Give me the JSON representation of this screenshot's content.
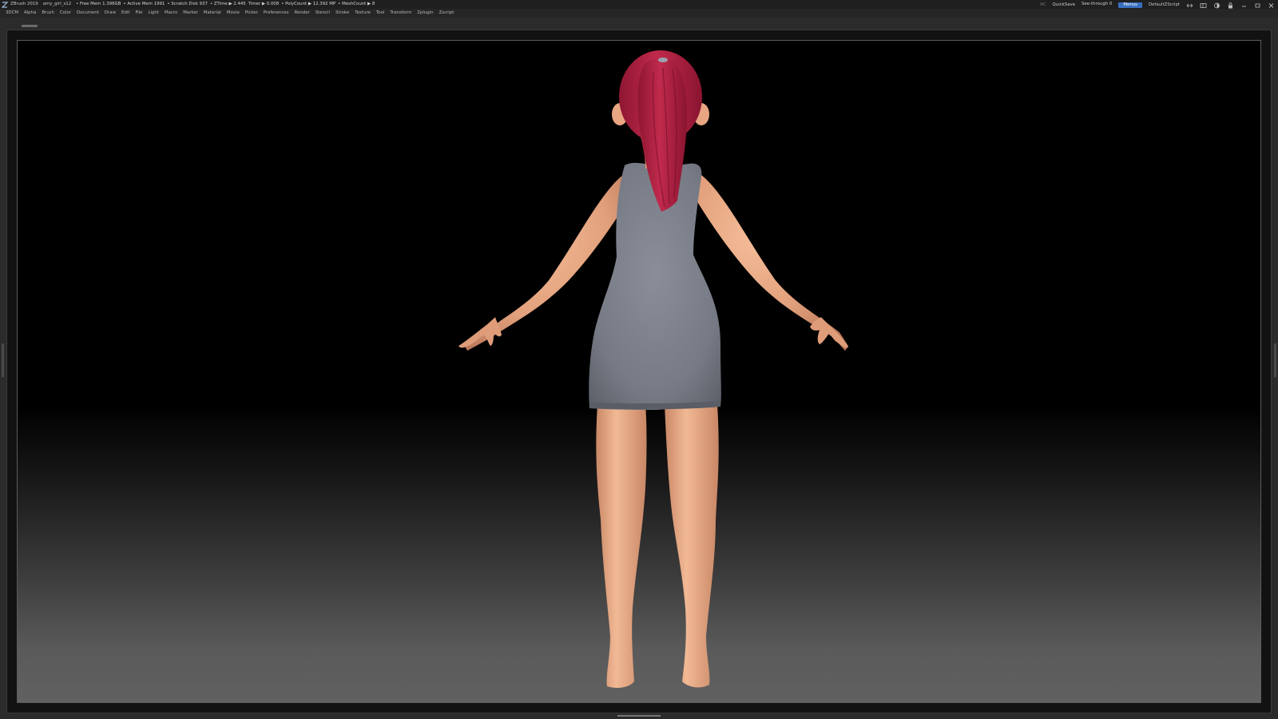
{
  "titlebar": {
    "app_name": "ZBrush 2019",
    "doc_name": "amy_girl_s12",
    "status": [
      "• Free Mem 1.396GB",
      "• Active Mem 1991",
      "• Scratch Disk 937",
      "• ZTime ▶ 2.445",
      "Timer ▶ 0.008",
      "• PolyCount ▶ 12.392 MP",
      "• MeshCount ▶ 8"
    ],
    "ac_label": "AC",
    "quicksave_label": "QuickSave",
    "see_through_label": "See-through",
    "see_through_value": "0",
    "see_through_level": 0.0,
    "menus_label": "Menus",
    "script_label": "DefaultZScript"
  },
  "menubar": {
    "items": [
      "3DCM",
      "Alpha",
      "Brush",
      "Color",
      "Document",
      "Draw",
      "Edit",
      "File",
      "Light",
      "Macro",
      "Marker",
      "Material",
      "Movie",
      "Picker",
      "Preferences",
      "Render",
      "Stencil",
      "Stroke",
      "Texture",
      "Tool",
      "Transform",
      "Zplugin",
      "Zscript"
    ]
  },
  "viewport": {
    "model_name": "female character, back view, A-pose",
    "colors": {
      "hair": "#a8203e",
      "skin": "#e8a682",
      "dress": "#7c808a",
      "background_top": "#000000",
      "background_bottom": "#616161"
    }
  }
}
